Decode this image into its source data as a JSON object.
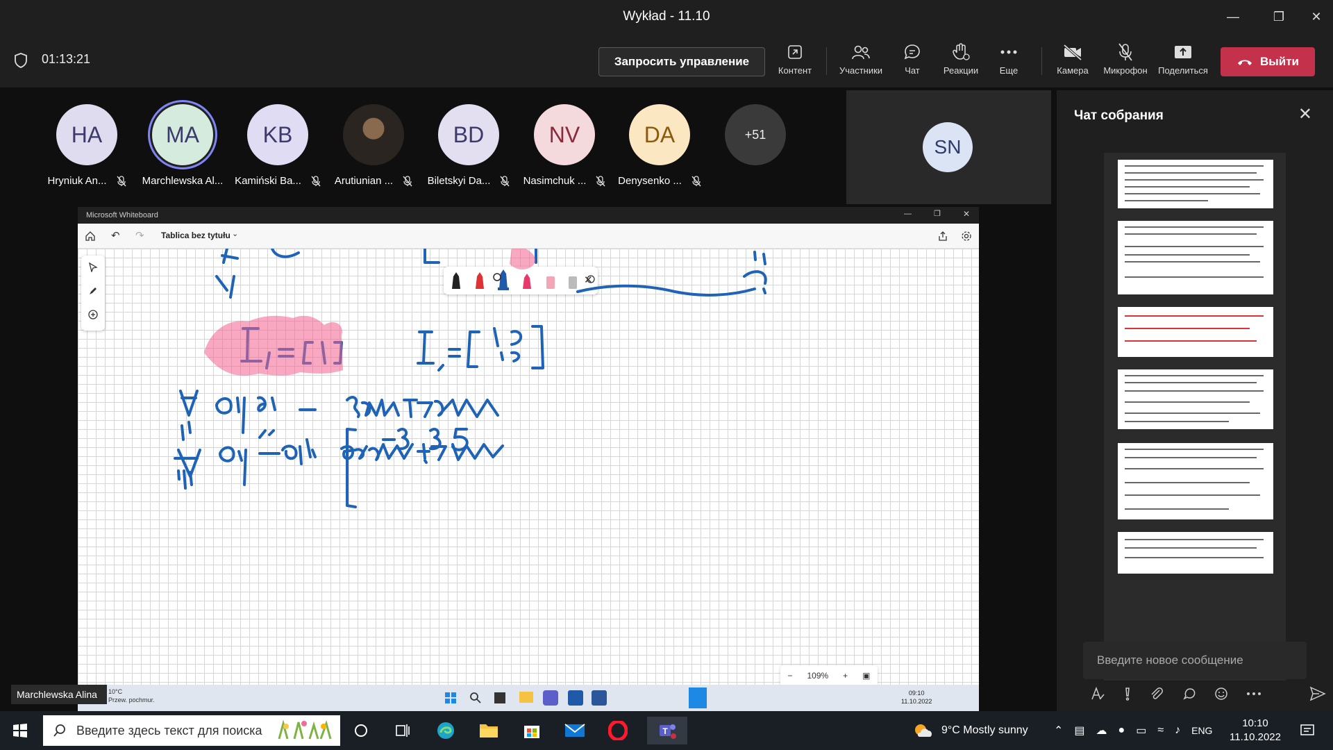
{
  "window": {
    "title": "Wykład - 11.10"
  },
  "toolbar": {
    "timer": "01:13:21",
    "request_control": "Запросить управление",
    "buttons": [
      {
        "label": "Контент",
        "icon": "share-content-icon"
      },
      {
        "label": "Участники",
        "icon": "people-icon"
      },
      {
        "label": "Чат",
        "icon": "chat-icon"
      },
      {
        "label": "Реакции",
        "icon": "reaction-hand-icon"
      },
      {
        "label": "Еще",
        "icon": "more-icon"
      },
      {
        "label": "Камера",
        "icon": "camera-off-icon"
      },
      {
        "label": "Микрофон",
        "icon": "mic-off-icon"
      },
      {
        "label": "Поделиться",
        "icon": "share-screen-icon"
      }
    ],
    "leave": "Выйти"
  },
  "participants": [
    {
      "initials": "HA",
      "name": "Hryniuk An...",
      "color": "#e0dcef"
    },
    {
      "initials": "MA",
      "name": "Marchlewska Al...",
      "color": "#d4ebdd"
    },
    {
      "initials": "KB",
      "name": "Kamiński Ba...",
      "color": "#dfdcf3"
    },
    {
      "initials": "",
      "name": "Arutiunian ...",
      "color": "#5b4a3a"
    },
    {
      "initials": "BD",
      "name": "Biletskyi Da...",
      "color": "#e3dff1"
    },
    {
      "initials": "NV",
      "name": "Nasimchuk ...",
      "color": "#f4d9dd"
    },
    {
      "initials": "DA",
      "name": "Denysenko ...",
      "color": "#fbe7c1"
    }
  ],
  "more_participants": "+51",
  "video_tile": {
    "initials": "SN"
  },
  "whiteboard": {
    "app_title": "Microsoft Whiteboard",
    "board_name": "Tablica bez tytułu",
    "zoom": "109%",
    "inner_taskbar": {
      "weather_temp": "10°C",
      "weather_desc": "Przew. pochmur.",
      "time": "09:10",
      "date": "11.10.2022"
    }
  },
  "presenter_name": "Marchlewska Alina",
  "chat": {
    "title": "Чат собрания",
    "input_placeholder": "Введите новое сообщение"
  },
  "taskbar": {
    "search_placeholder": "Введите здесь текст для поиска",
    "weather": "9°C  Mostly sunny",
    "lang": "ENG",
    "time": "10:10",
    "date": "11.10.2022"
  }
}
